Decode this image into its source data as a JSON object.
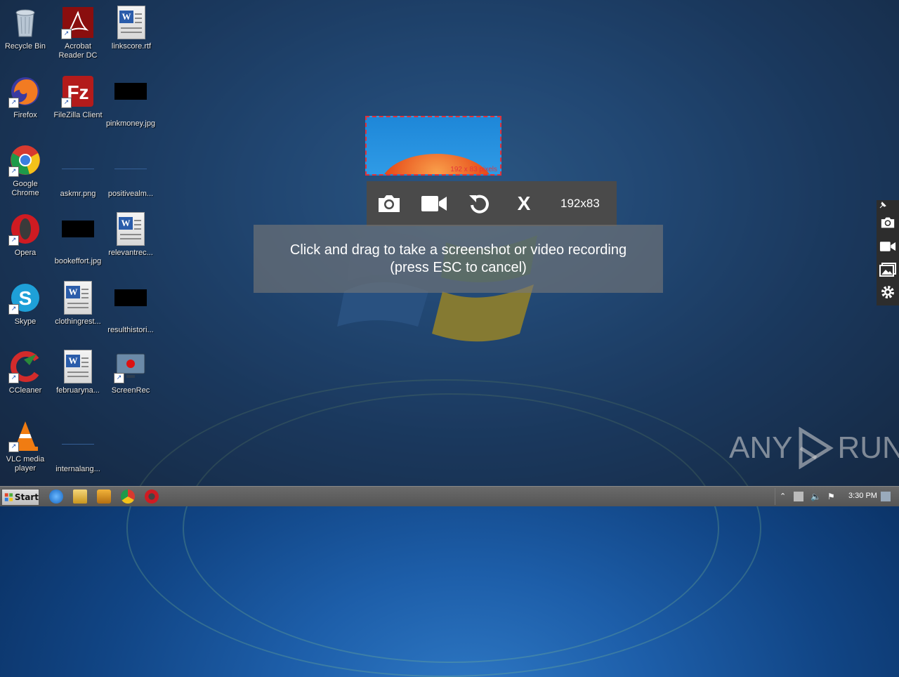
{
  "desktop": {
    "icons": [
      {
        "label": "Recycle Bin",
        "icon": "recycle-bin-icon"
      },
      {
        "label": "Acrobat Reader DC",
        "icon": "acrobat-icon"
      },
      {
        "label": "linkscore.rtf",
        "icon": "word-document-icon"
      },
      {
        "label": "Firefox",
        "icon": "firefox-icon"
      },
      {
        "label": "FileZilla Client",
        "icon": "filezilla-icon"
      },
      {
        "label": "pinkmoney.jpg",
        "icon": "image-file-icon"
      },
      {
        "label": "Google Chrome",
        "icon": "chrome-icon"
      },
      {
        "label": "askmr.png",
        "icon": "image-file-icon"
      },
      {
        "label": "positivealm...",
        "icon": "image-file-icon"
      },
      {
        "label": "Opera",
        "icon": "opera-icon"
      },
      {
        "label": "bookeffort.jpg",
        "icon": "image-file-icon"
      },
      {
        "label": "relevantrec...",
        "icon": "word-document-icon"
      },
      {
        "label": "Skype",
        "icon": "skype-icon"
      },
      {
        "label": "clothingrest...",
        "icon": "word-document-icon"
      },
      {
        "label": "resulthistori...",
        "icon": "image-file-icon"
      },
      {
        "label": "CCleaner",
        "icon": "ccleaner-icon"
      },
      {
        "label": "februaryna...",
        "icon": "word-document-icon"
      },
      {
        "label": "ScreenRec",
        "icon": "screenrec-icon"
      },
      {
        "label": "VLC media player",
        "icon": "vlc-icon"
      },
      {
        "label": "internalang...",
        "icon": "image-file-icon"
      }
    ]
  },
  "selection": {
    "dims_label": "192 x 83 pixels"
  },
  "toolbar": {
    "size_label": "192x83",
    "close_label": "X",
    "accent": "#e2323a"
  },
  "hint": {
    "line1": "Click and drag to take a screenshot or video recording",
    "line2": "(press ESC to cancel)"
  },
  "watermark": {
    "left": "ANY",
    "right": "RUN"
  },
  "taskbar": {
    "start_label": "Start",
    "clock": "3:30 PM"
  }
}
